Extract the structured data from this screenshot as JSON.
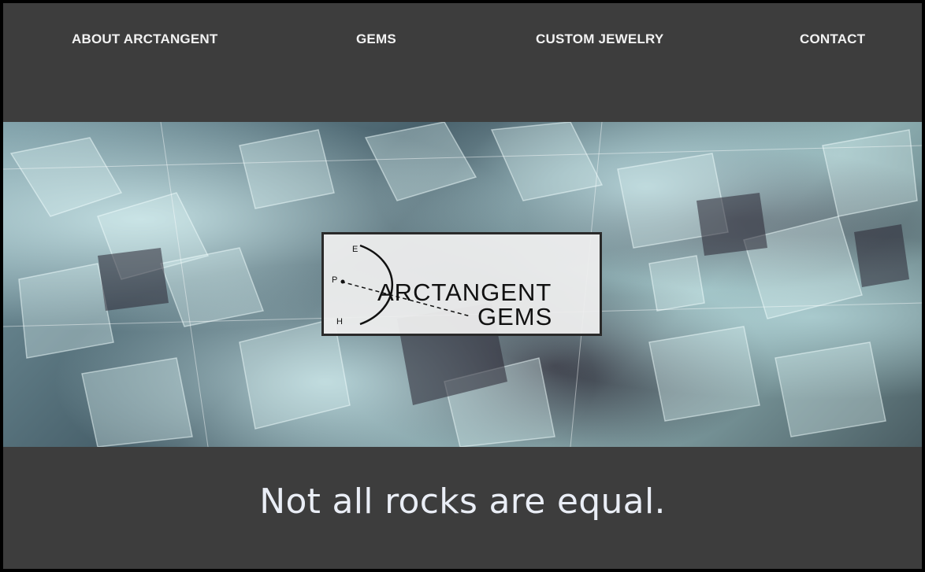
{
  "nav": {
    "items": [
      {
        "label": "ABOUT ARCTANGENT"
      },
      {
        "label": "GEMS"
      },
      {
        "label": "CUSTOM JEWELRY"
      },
      {
        "label": "CONTACT"
      }
    ]
  },
  "hero": {
    "logo": {
      "wordmark_line1": "ARCTANGENT",
      "wordmark_line2": "GEMS",
      "arc_labels": [
        "E",
        "P",
        "H"
      ]
    }
  },
  "tagline": "Not all rocks are equal.",
  "colors": {
    "page_background": "#3d3d3d",
    "nav_text": "#f2f2f2",
    "tagline_text": "#eaeef6",
    "logo_background": "#eeeeee"
  }
}
